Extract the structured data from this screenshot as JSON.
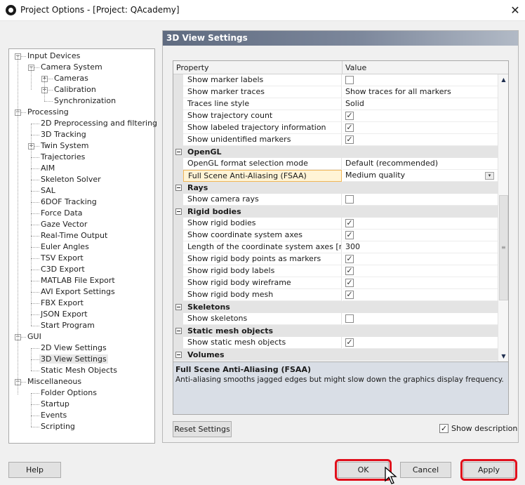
{
  "window": {
    "title": "Project Options - [Project: QAcademy]",
    "close_glyph": "✕"
  },
  "tree": [
    {
      "label": "Input Devices",
      "expander": "−"
    },
    {
      "label": "Camera System",
      "expander": "−"
    },
    {
      "label": "Cameras",
      "expander": "+"
    },
    {
      "label": "Calibration",
      "expander": "+"
    },
    {
      "label": "Synchronization"
    },
    {
      "label": "Processing",
      "expander": "−"
    },
    {
      "label": "2D Preprocessing and filtering"
    },
    {
      "label": "3D Tracking"
    },
    {
      "label": "Twin System",
      "expander": "+"
    },
    {
      "label": "Trajectories"
    },
    {
      "label": "AIM"
    },
    {
      "label": "Skeleton Solver"
    },
    {
      "label": "SAL"
    },
    {
      "label": "6DOF Tracking"
    },
    {
      "label": "Force Data"
    },
    {
      "label": "Gaze Vector"
    },
    {
      "label": "Real-Time Output"
    },
    {
      "label": "Euler Angles"
    },
    {
      "label": "TSV Export"
    },
    {
      "label": "C3D Export"
    },
    {
      "label": "MATLAB File Export"
    },
    {
      "label": "AVI Export Settings"
    },
    {
      "label": "FBX Export"
    },
    {
      "label": "JSON Export"
    },
    {
      "label": "Start Program"
    },
    {
      "label": "GUI",
      "expander": "−"
    },
    {
      "label": "2D View Settings"
    },
    {
      "label": "3D View Settings"
    },
    {
      "label": "Static Mesh Objects"
    },
    {
      "label": "Miscellaneous",
      "expander": "−"
    },
    {
      "label": "Folder Options"
    },
    {
      "label": "Startup"
    },
    {
      "label": "Events"
    },
    {
      "label": "Scripting"
    }
  ],
  "panel": {
    "title": "3D View Settings",
    "columns": {
      "property": "Property",
      "value": "Value"
    },
    "rows": [
      {
        "type": "prop",
        "name": "Show marker labels",
        "checkbox": false
      },
      {
        "type": "prop",
        "name": "Show marker traces",
        "value": "Show traces for all markers"
      },
      {
        "type": "prop",
        "name": "Traces line style",
        "value": "Solid"
      },
      {
        "type": "prop",
        "name": "Show trajectory count",
        "checkbox": true
      },
      {
        "type": "prop",
        "name": "Show labeled trajectory information",
        "checkbox": true
      },
      {
        "type": "prop",
        "name": "Show unidentified markers",
        "checkbox": true
      },
      {
        "type": "cat",
        "name": "OpenGL"
      },
      {
        "type": "prop",
        "name": "OpenGL format selection mode",
        "value": "Default (recommended)"
      },
      {
        "type": "prop",
        "name": "Full Scene Anti-Aliasing (FSAA)",
        "value": "Medium quality",
        "dropdown": true,
        "selected": true
      },
      {
        "type": "cat",
        "name": "Rays"
      },
      {
        "type": "prop",
        "name": "Show camera rays",
        "checkbox": false
      },
      {
        "type": "cat",
        "name": "Rigid bodies"
      },
      {
        "type": "prop",
        "name": "Show rigid bodies",
        "checkbox": true
      },
      {
        "type": "prop",
        "name": "Show coordinate system axes",
        "checkbox": true
      },
      {
        "type": "prop",
        "name": "Length of the coordinate system axes [mm]",
        "value": "300"
      },
      {
        "type": "prop",
        "name": "Show rigid body points as markers",
        "checkbox": true
      },
      {
        "type": "prop",
        "name": "Show rigid body labels",
        "checkbox": true
      },
      {
        "type": "prop",
        "name": "Show rigid body wireframe",
        "checkbox": true
      },
      {
        "type": "prop",
        "name": "Show rigid body mesh",
        "checkbox": true
      },
      {
        "type": "cat",
        "name": "Skeletons"
      },
      {
        "type": "prop",
        "name": "Show skeletons",
        "checkbox": false
      },
      {
        "type": "cat",
        "name": "Static mesh objects"
      },
      {
        "type": "prop",
        "name": "Show static mesh objects",
        "checkbox": true
      },
      {
        "type": "cat",
        "name": "Volumes"
      }
    ],
    "description": {
      "title": "Full Scene Anti-Aliasing (FSAA)",
      "text": "Anti-aliasing smooths jagged edges but might slow down the graphics display frequency."
    },
    "reset_label": "Reset Settings",
    "show_description_label": "Show description",
    "show_description_checked": true
  },
  "buttons": {
    "help": "Help",
    "ok": "OK",
    "cancel": "Cancel",
    "apply": "Apply"
  },
  "colors": {
    "highlight": "#e0101c",
    "selection": "#f0b659",
    "header": "#6b778c"
  }
}
